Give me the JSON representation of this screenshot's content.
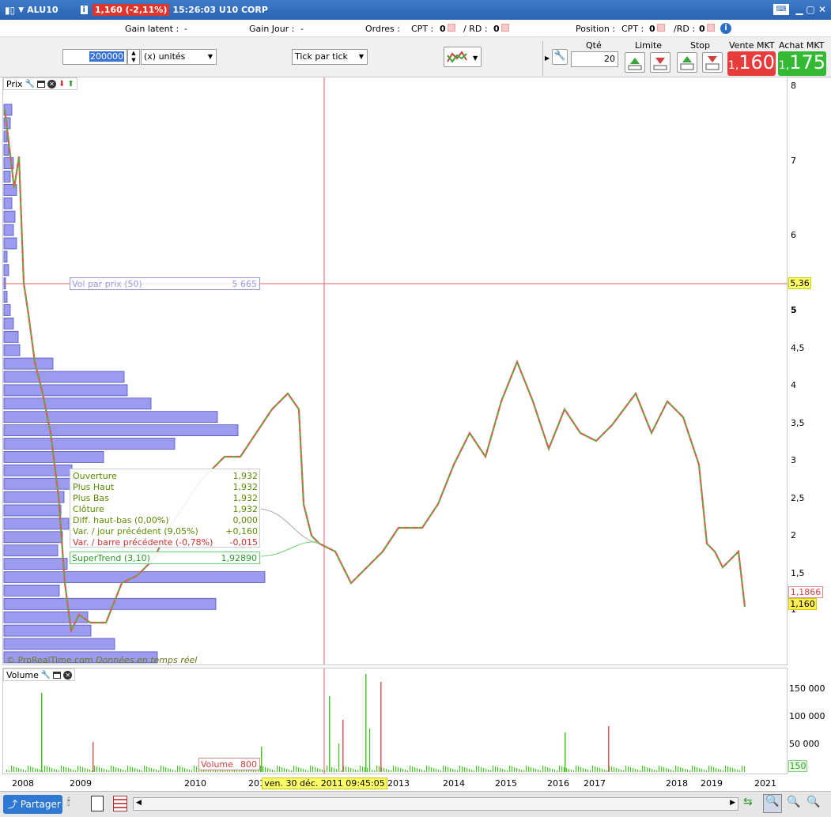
{
  "window": {
    "symbol": "ALU10",
    "change": "1,160 (-2,11%)",
    "time": "15:26:03 U10 CORP"
  },
  "info": {
    "gain_latent": "Gain latent :",
    "gain_latent_val": "-",
    "gain_jour": "Gain Jour :",
    "gain_jour_val": "-",
    "ordres": "Ordres :",
    "cpt": "CPT :",
    "cpt_val": "0",
    "rd": "/ RD :",
    "rd_val": "0",
    "position": "Position :",
    "pos_cpt": "CPT :",
    "pos_cpt_val": "0",
    "pos_rd": "/RD :",
    "pos_rd_val": "0"
  },
  "toolbar": {
    "qty_value": "200000",
    "units": "(x) unités",
    "mode": "Tick par tick",
    "qte_label": "Qté",
    "qte_value": "20",
    "limite": "Limite",
    "stop": "Stop",
    "vente_label": "Vente MKT",
    "achat_label": "Achat MKT",
    "vente_small": "1,",
    "vente_big": "160",
    "achat_small": "1,",
    "achat_big": "175"
  },
  "price_panel": {
    "title": "Prix",
    "copyright": "© ProRealTime.com",
    "realtime": "Données en temps réel",
    "vol_label": "Vol par prix (50)",
    "vol_value": "5 665",
    "crosshair_price": "5,36",
    "last1": "1,1866",
    "last2": "1,160",
    "yticks": [
      "8",
      "7",
      "6",
      "5",
      "4,5",
      "4",
      "3,5",
      "3",
      "2,5",
      "2",
      "1,5",
      "1"
    ]
  },
  "tooltip": {
    "rows": [
      {
        "label": "Ouverture",
        "value": "1,932",
        "color": "#5a8a00"
      },
      {
        "label": "Plus Haut",
        "value": "1,932",
        "color": "#5a8a00"
      },
      {
        "label": "Plus Bas",
        "value": "1,932",
        "color": "#5a8a00"
      },
      {
        "label": "Clôture",
        "value": "1,932",
        "color": "#5a8a00"
      },
      {
        "label": "Diff. haut-bas (0,00%)",
        "value": "0,000",
        "color": "#5a8a00"
      },
      {
        "label": "Var. / jour précédent (9,05%)",
        "value": "+0,160",
        "color": "#5a8a00"
      },
      {
        "label": "Var. / barre précédente (-0,78%)",
        "value": "-0,015",
        "color": "#d03030"
      }
    ],
    "supertrend_label": "SuperTrend (3,10)",
    "supertrend_value": "1,92890"
  },
  "volume_panel": {
    "title": "Volume",
    "yticks": [
      "150 000",
      "100 000",
      "50 000"
    ],
    "last": "150",
    "vol_label": "Volume",
    "vol_value": "800"
  },
  "xaxis": {
    "labels": [
      "2008",
      "2009",
      "2010",
      "201",
      "2013",
      "2014",
      "2015",
      "2016",
      "2017",
      "2018",
      "2019",
      "2021"
    ],
    "crosshair_date": "ven. 30 déc. 2011 09:45:05"
  },
  "bottom": {
    "share": "Partager"
  },
  "colors": {
    "up": "#44c425",
    "down": "#d85a5a",
    "volbar": "#9b9bf0",
    "crosshair": "#e06060"
  }
}
